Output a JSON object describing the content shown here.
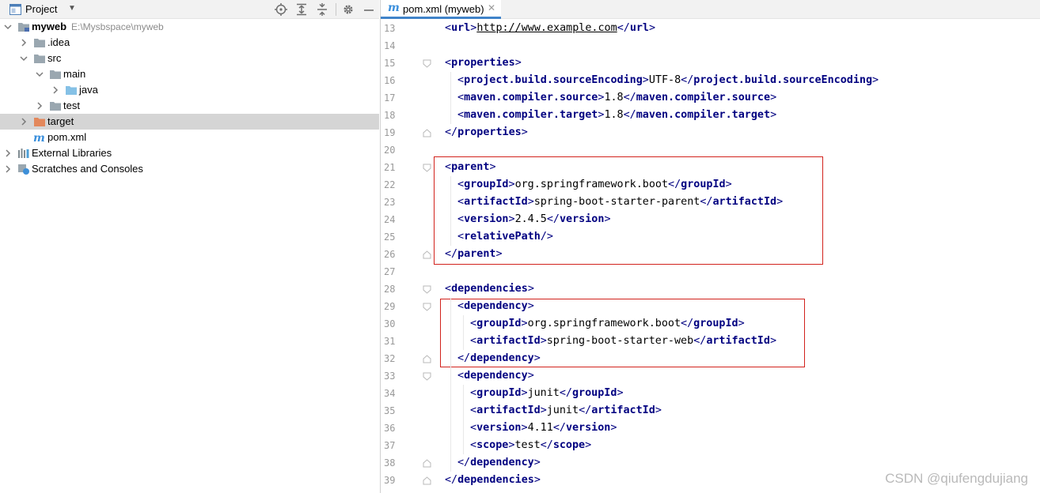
{
  "project_panel": {
    "title": "Project",
    "tree": [
      {
        "label": "myweb",
        "path": "E:\\Mysbspace\\myweb",
        "icon": "module-folder-icon",
        "expanded": true,
        "depth": 0
      },
      {
        "label": ".idea",
        "icon": "folder-icon",
        "expanded": false,
        "depth": 1
      },
      {
        "label": "src",
        "icon": "folder-icon",
        "expanded": true,
        "depth": 1
      },
      {
        "label": "main",
        "icon": "folder-icon",
        "expanded": true,
        "depth": 2
      },
      {
        "label": "java",
        "icon": "source-folder-icon",
        "expanded": false,
        "depth": 3
      },
      {
        "label": "test",
        "icon": "folder-icon",
        "expanded": false,
        "depth": 2
      },
      {
        "label": "target",
        "icon": "excluded-folder-icon",
        "expanded": false,
        "depth": 1,
        "selected": true
      },
      {
        "label": "pom.xml",
        "icon": "maven-file-icon",
        "depth": 1
      },
      {
        "label": "External Libraries",
        "icon": "libraries-icon",
        "expanded": false,
        "depth": 0
      },
      {
        "label": "Scratches and Consoles",
        "icon": "scratches-icon",
        "expanded": false,
        "depth": 0
      }
    ]
  },
  "editor": {
    "tab_label": "pom.xml (myweb)",
    "lines": [
      {
        "n": "13",
        "indent": 0,
        "parts": [
          [
            "brk",
            "<"
          ],
          [
            "tag",
            "url"
          ],
          [
            "brk",
            ">"
          ],
          [
            "url",
            "http://www.example.com"
          ],
          [
            "brk",
            "</"
          ],
          [
            "tag",
            "url"
          ],
          [
            "brk",
            ">"
          ]
        ]
      },
      {
        "n": "14",
        "indent": 0,
        "parts": []
      },
      {
        "n": "15",
        "indent": 0,
        "fold": "open",
        "parts": [
          [
            "brk",
            "<"
          ],
          [
            "tag",
            "properties"
          ],
          [
            "brk",
            ">"
          ]
        ]
      },
      {
        "n": "16",
        "indent": 1,
        "parts": [
          [
            "brk",
            "<"
          ],
          [
            "tag",
            "project.build.sourceEncoding"
          ],
          [
            "brk",
            ">"
          ],
          [
            "txt",
            "UTF-8"
          ],
          [
            "brk",
            "</"
          ],
          [
            "tag",
            "project.build.sourceEncoding"
          ],
          [
            "brk",
            ">"
          ]
        ]
      },
      {
        "n": "17",
        "indent": 1,
        "parts": [
          [
            "brk",
            "<"
          ],
          [
            "tag",
            "maven.compiler.source"
          ],
          [
            "brk",
            ">"
          ],
          [
            "txt",
            "1.8"
          ],
          [
            "brk",
            "</"
          ],
          [
            "tag",
            "maven.compiler.source"
          ],
          [
            "brk",
            ">"
          ]
        ]
      },
      {
        "n": "18",
        "indent": 1,
        "parts": [
          [
            "brk",
            "<"
          ],
          [
            "tag",
            "maven.compiler.target"
          ],
          [
            "brk",
            ">"
          ],
          [
            "txt",
            "1.8"
          ],
          [
            "brk",
            "</"
          ],
          [
            "tag",
            "maven.compiler.target"
          ],
          [
            "brk",
            ">"
          ]
        ]
      },
      {
        "n": "19",
        "indent": 0,
        "fold": "close",
        "parts": [
          [
            "brk",
            "</"
          ],
          [
            "tag",
            "properties"
          ],
          [
            "brk",
            ">"
          ]
        ]
      },
      {
        "n": "20",
        "indent": 0,
        "parts": []
      },
      {
        "n": "21",
        "indent": 0,
        "fold": "open",
        "parts": [
          [
            "brk",
            "<"
          ],
          [
            "tag",
            "parent"
          ],
          [
            "brk",
            ">"
          ]
        ]
      },
      {
        "n": "22",
        "indent": 1,
        "parts": [
          [
            "brk",
            "<"
          ],
          [
            "tag",
            "groupId"
          ],
          [
            "brk",
            ">"
          ],
          [
            "txt",
            "org.springframework.boot"
          ],
          [
            "brk",
            "</"
          ],
          [
            "tag",
            "groupId"
          ],
          [
            "brk",
            ">"
          ]
        ]
      },
      {
        "n": "23",
        "indent": 1,
        "parts": [
          [
            "brk",
            "<"
          ],
          [
            "tag",
            "artifactId"
          ],
          [
            "brk",
            ">"
          ],
          [
            "txt",
            "spring-boot-starter-parent"
          ],
          [
            "brk",
            "</"
          ],
          [
            "tag",
            "artifactId"
          ],
          [
            "brk",
            ">"
          ]
        ]
      },
      {
        "n": "24",
        "indent": 1,
        "parts": [
          [
            "brk",
            "<"
          ],
          [
            "tag",
            "version"
          ],
          [
            "brk",
            ">"
          ],
          [
            "txt",
            "2.4.5"
          ],
          [
            "brk",
            "</"
          ],
          [
            "tag",
            "version"
          ],
          [
            "brk",
            ">"
          ]
        ]
      },
      {
        "n": "25",
        "indent": 1,
        "parts": [
          [
            "brk",
            "<"
          ],
          [
            "tag",
            "relativePath"
          ],
          [
            "brk",
            "/>"
          ]
        ]
      },
      {
        "n": "26",
        "indent": 0,
        "fold": "close",
        "parts": [
          [
            "brk",
            "</"
          ],
          [
            "tag",
            "parent"
          ],
          [
            "brk",
            ">"
          ]
        ]
      },
      {
        "n": "27",
        "indent": 0,
        "parts": []
      },
      {
        "n": "28",
        "indent": 0,
        "fold": "open",
        "parts": [
          [
            "brk",
            "<"
          ],
          [
            "tag",
            "dependencies"
          ],
          [
            "brk",
            ">"
          ]
        ]
      },
      {
        "n": "29",
        "indent": 1,
        "fold": "open",
        "parts": [
          [
            "brk",
            "<"
          ],
          [
            "tag",
            "dependency"
          ],
          [
            "brk",
            ">"
          ]
        ]
      },
      {
        "n": "30",
        "indent": 2,
        "parts": [
          [
            "brk",
            "<"
          ],
          [
            "tag",
            "groupId"
          ],
          [
            "brk",
            ">"
          ],
          [
            "txt",
            "org.springframework.boot"
          ],
          [
            "brk",
            "</"
          ],
          [
            "tag",
            "groupId"
          ],
          [
            "brk",
            ">"
          ]
        ]
      },
      {
        "n": "31",
        "indent": 2,
        "parts": [
          [
            "brk",
            "<"
          ],
          [
            "tag",
            "artifactId"
          ],
          [
            "brk",
            ">"
          ],
          [
            "txt",
            "spring-boot-starter-web"
          ],
          [
            "brk",
            "</"
          ],
          [
            "tag",
            "artifactId"
          ],
          [
            "brk",
            ">"
          ]
        ]
      },
      {
        "n": "32",
        "indent": 1,
        "fold": "close",
        "parts": [
          [
            "brk",
            "</"
          ],
          [
            "tag",
            "dependency"
          ],
          [
            "brk",
            ">"
          ]
        ]
      },
      {
        "n": "33",
        "indent": 1,
        "fold": "open",
        "parts": [
          [
            "brk",
            "<"
          ],
          [
            "tag",
            "dependency"
          ],
          [
            "brk",
            ">"
          ]
        ]
      },
      {
        "n": "34",
        "indent": 2,
        "parts": [
          [
            "brk",
            "<"
          ],
          [
            "tag",
            "groupId"
          ],
          [
            "brk",
            ">"
          ],
          [
            "txt",
            "junit"
          ],
          [
            "brk",
            "</"
          ],
          [
            "tag",
            "groupId"
          ],
          [
            "brk",
            ">"
          ]
        ]
      },
      {
        "n": "35",
        "indent": 2,
        "parts": [
          [
            "brk",
            "<"
          ],
          [
            "tag",
            "artifactId"
          ],
          [
            "brk",
            ">"
          ],
          [
            "txt",
            "junit"
          ],
          [
            "brk",
            "</"
          ],
          [
            "tag",
            "artifactId"
          ],
          [
            "brk",
            ">"
          ]
        ]
      },
      {
        "n": "36",
        "indent": 2,
        "parts": [
          [
            "brk",
            "<"
          ],
          [
            "tag",
            "version"
          ],
          [
            "brk",
            ">"
          ],
          [
            "txt",
            "4.11"
          ],
          [
            "brk",
            "</"
          ],
          [
            "tag",
            "version"
          ],
          [
            "brk",
            ">"
          ]
        ]
      },
      {
        "n": "37",
        "indent": 2,
        "parts": [
          [
            "brk",
            "<"
          ],
          [
            "tag",
            "scope"
          ],
          [
            "brk",
            ">"
          ],
          [
            "txt",
            "test"
          ],
          [
            "brk",
            "</"
          ],
          [
            "tag",
            "scope"
          ],
          [
            "brk",
            ">"
          ]
        ]
      },
      {
        "n": "38",
        "indent": 1,
        "fold": "close",
        "parts": [
          [
            "brk",
            "</"
          ],
          [
            "tag",
            "dependency"
          ],
          [
            "brk",
            ">"
          ]
        ]
      },
      {
        "n": "39",
        "indent": 0,
        "fold": "close",
        "parts": [
          [
            "brk",
            "</"
          ],
          [
            "tag",
            "dependencies"
          ],
          [
            "brk",
            ">"
          ]
        ]
      }
    ]
  },
  "watermark": "CSDN @qiufengdujiang",
  "colors": {
    "tag": "#000080",
    "highlight_box": "#d2221c",
    "selection": "#d5d5d5",
    "tab_underline": "#4083c9"
  }
}
